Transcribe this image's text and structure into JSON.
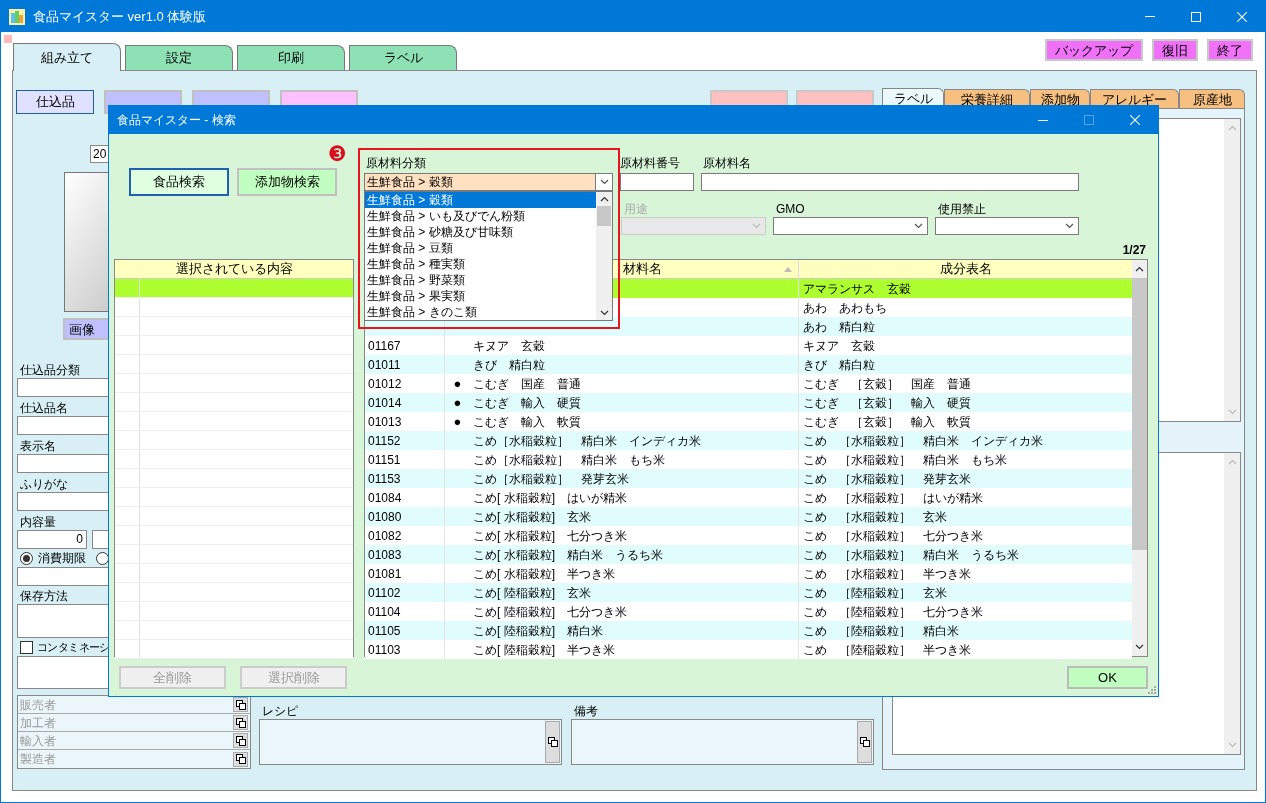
{
  "window": {
    "title": "食品マイスター ver1.0 体験版"
  },
  "main_tabs": [
    {
      "label": "組み立て",
      "selected": true
    },
    {
      "label": "設定",
      "selected": false
    },
    {
      "label": "印刷",
      "selected": false
    },
    {
      "label": "ラベル",
      "selected": false
    }
  ],
  "top_buttons": [
    "バックアップ",
    "復旧",
    "終了"
  ],
  "category_buttons": [
    {
      "label": "仕込品",
      "selected": true,
      "color": "#e0e0ff"
    },
    {
      "selected": false,
      "color": "#c0c0ff"
    },
    {
      "selected": false,
      "color": "#c0c0ff"
    },
    {
      "selected": false,
      "color": "#ffc0ff"
    }
  ],
  "side_tabs": [
    {
      "label": "ラベル",
      "selected": true
    },
    {
      "label": "栄養詳細",
      "selected": false
    },
    {
      "label": "添加物",
      "selected": false
    },
    {
      "label": "アレルギー",
      "selected": false
    },
    {
      "label": "原産地",
      "selected": false
    }
  ],
  "form": {
    "date_value": "20",
    "image_button": "画像",
    "fields": [
      {
        "label": "仕込品分類"
      },
      {
        "label": "仕込品名"
      },
      {
        "label": "表示名"
      },
      {
        "label": "ふりがな"
      }
    ],
    "quantity": {
      "label": "内容量",
      "value": "0"
    },
    "expiry_options": [
      {
        "label": "消費期限",
        "selected": true
      },
      {
        "selected": false
      }
    ],
    "storage_label": "保存方法",
    "contamination": {
      "label": "コンタミネーシ",
      "checked": false
    }
  },
  "parties": [
    "販売者",
    "加工者",
    "輸入者",
    "製造者"
  ],
  "recipe": {
    "label": "レシピ"
  },
  "notes": {
    "label": "備考"
  },
  "dialog": {
    "title": "食品マイスター - 検索",
    "search_modes": [
      {
        "label": "食品検索",
        "selected": true
      },
      {
        "label": "添加物検索",
        "selected": false
      }
    ],
    "annotation": "❸",
    "category": {
      "label": "原材料分類",
      "value": "生鮮食品 > 穀類",
      "options": [
        {
          "label": "生鮮食品 > 穀類",
          "selected": true
        },
        {
          "label": "生鮮食品 > いも及びでん粉類",
          "selected": false
        },
        {
          "label": "生鮮食品 > 砂糖及び甘味類",
          "selected": false
        },
        {
          "label": "生鮮食品 > 豆類",
          "selected": false
        },
        {
          "label": "生鮮食品 > 種実類",
          "selected": false
        },
        {
          "label": "生鮮食品 > 野菜類",
          "selected": false
        },
        {
          "label": "生鮮食品 > 果実類",
          "selected": false
        },
        {
          "label": "生鮮食品 > きのこ類",
          "selected": false
        }
      ]
    },
    "number_label": "原材料番号",
    "name_label": "原材料名",
    "usage": {
      "label": "用途",
      "disabled": true
    },
    "gmo_label": "GMO",
    "prohibited_label": "使用禁止",
    "page": "1/27",
    "selected_table": {
      "header": "選択されている内容",
      "rows": [
        {
          "selected": true
        },
        {
          "selected": false
        },
        {
          "selected": false
        },
        {
          "selected": false
        },
        {
          "selected": false
        },
        {
          "selected": false
        },
        {
          "selected": false
        },
        {
          "selected": false
        },
        {
          "selected": false
        },
        {
          "selected": false
        },
        {
          "selected": false
        },
        {
          "selected": false
        },
        {
          "selected": false
        },
        {
          "selected": false
        },
        {
          "selected": false
        },
        {
          "selected": false
        },
        {
          "selected": false
        },
        {
          "selected": false
        },
        {
          "selected": false
        },
        {
          "selected": false
        }
      ]
    },
    "results": {
      "columns": [
        "材料名",
        "成分表名"
      ],
      "rows": [
        {
          "ingredient": "アマランサス　玄穀",
          "selected": true
        },
        {
          "ingredient": "あわ　あわもち",
          "selected": false
        },
        {
          "ingredient": "あわ　精白粒",
          "selected": false
        },
        {
          "code": "01167",
          "name": "キヌア　玄穀",
          "ingredient": "キヌア　玄穀",
          "selected": false
        },
        {
          "code": "01011",
          "name": "きび　精白粒",
          "ingredient": "きび　精白粒",
          "selected": false
        },
        {
          "code": "01012",
          "mark": "●",
          "name": "こむぎ　国産　普通",
          "ingredient": "こむぎ　［玄穀］　国産　普通",
          "selected": false
        },
        {
          "code": "01014",
          "mark": "●",
          "name": "こむぎ　輸入　硬質",
          "ingredient": "こむぎ　［玄穀］　輸入　硬質",
          "selected": false
        },
        {
          "code": "01013",
          "mark": "●",
          "name": "こむぎ　輸入　軟質",
          "ingredient": "こむぎ　［玄穀］　輸入　軟質",
          "selected": false
        },
        {
          "code": "01152",
          "name": "こめ［水稲穀粒］　精白米　インディカ米",
          "ingredient": "こめ　［水稲穀粒］　精白米　インディカ米",
          "selected": false
        },
        {
          "code": "01151",
          "name": "こめ［水稲穀粒］　精白米　もち米",
          "ingredient": "こめ　［水稲穀粒］　精白米　もち米",
          "selected": false
        },
        {
          "code": "01153",
          "name": "こめ［水稲穀粒］　発芽玄米",
          "ingredient": "こめ　［水稲穀粒］　発芽玄米",
          "selected": false
        },
        {
          "code": "01084",
          "name": "こめ[ 水稲穀粒]　はいが精米",
          "ingredient": "こめ　［水稲穀粒］　はいが精米",
          "selected": false
        },
        {
          "code": "01080",
          "name": "こめ[ 水稲穀粒]　玄米",
          "ingredient": "こめ　［水稲穀粒］　玄米",
          "selected": false
        },
        {
          "code": "01082",
          "name": "こめ[ 水稲穀粒]　七分つき米",
          "ingredient": "こめ　［水稲穀粒］　七分つき米",
          "selected": false
        },
        {
          "code": "01083",
          "name": "こめ[ 水稲穀粒]　精白米　うるち米",
          "ingredient": "こめ　［水稲穀粒］　精白米　うるち米",
          "selected": false
        },
        {
          "code": "01081",
          "name": "こめ[ 水稲穀粒]　半つき米",
          "ingredient": "こめ　［水稲穀粒］　半つき米",
          "selected": false
        },
        {
          "code": "01102",
          "name": "こめ[ 陸稲穀粒]　玄米",
          "ingredient": "こめ　［陸稲穀粒］　玄米",
          "selected": false
        },
        {
          "code": "01104",
          "name": "こめ[ 陸稲穀粒]　七分つき米",
          "ingredient": "こめ　［陸稲穀粒］　七分つき米",
          "selected": false
        },
        {
          "code": "01105",
          "name": "こめ[ 陸稲穀粒]　精白米",
          "ingredient": "こめ　［陸稲穀粒］　精白米",
          "selected": false
        },
        {
          "code": "01103",
          "name": "こめ[ 陸稲穀粒]　半つき米",
          "ingredient": "こめ　［陸稲穀粒］　半つき米",
          "selected": false
        }
      ]
    },
    "buttons": [
      {
        "label": "全削除",
        "disabled": true
      },
      {
        "label": "選択削除",
        "disabled": true
      }
    ],
    "ok": "OK"
  }
}
